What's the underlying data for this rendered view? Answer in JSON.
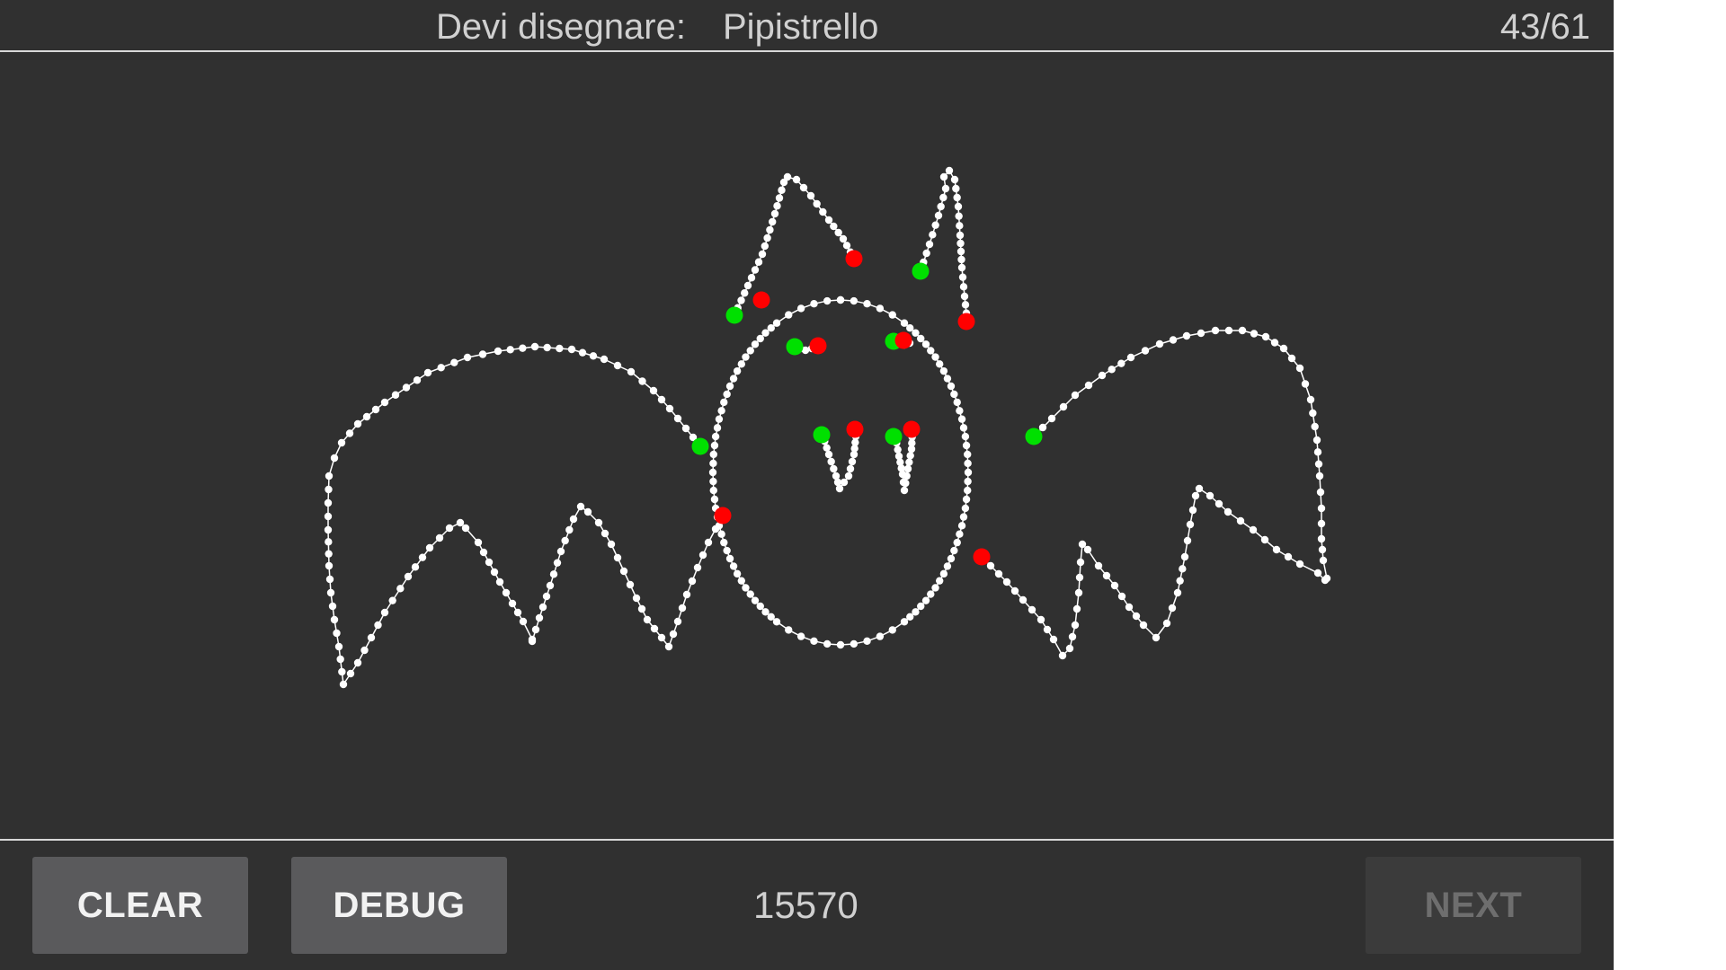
{
  "header": {
    "prompt_label": "Devi disegnare:",
    "prompt_word": "Pipistrello",
    "progress": "43/61"
  },
  "footer": {
    "clear_label": "CLEAR",
    "debug_label": "DEBUG",
    "score": "15570",
    "next_label": "NEXT",
    "next_enabled": false
  },
  "drawing": {
    "subject": "bat",
    "stroke_color": "#ffffff",
    "stroke_start_color": "#00e000",
    "stroke_end_color": "#ff0000",
    "background_color": "#303030"
  }
}
